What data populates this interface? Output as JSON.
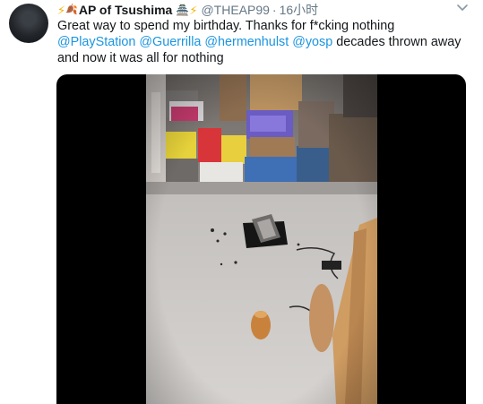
{
  "tweet": {
    "author": {
      "display_name": "AP of Tsushima",
      "handle": "@THEAP99",
      "avatar_icon": "profile-avatar",
      "name_emoji_before": [
        "⚡",
        "🍂"
      ],
      "name_emoji_after": [
        "🏯",
        "⚡"
      ]
    },
    "separator": "·",
    "time": "16小时",
    "text": {
      "line1": "Great way to spend my birthday. Thanks for f*cking nothing",
      "mentions": [
        "@PlayStation",
        "@Guerrilla",
        "@hermenhulst",
        "@yosp"
      ],
      "after_mentions": "decades thrown away",
      "line3": "and now it was all for nothing"
    },
    "media": {
      "type": "video",
      "icon": "video-thumbnail"
    }
  },
  "colors": {
    "text": "#14171a",
    "secondary": "#657786",
    "link": "#1b95e0",
    "media_background": "#000000"
  }
}
